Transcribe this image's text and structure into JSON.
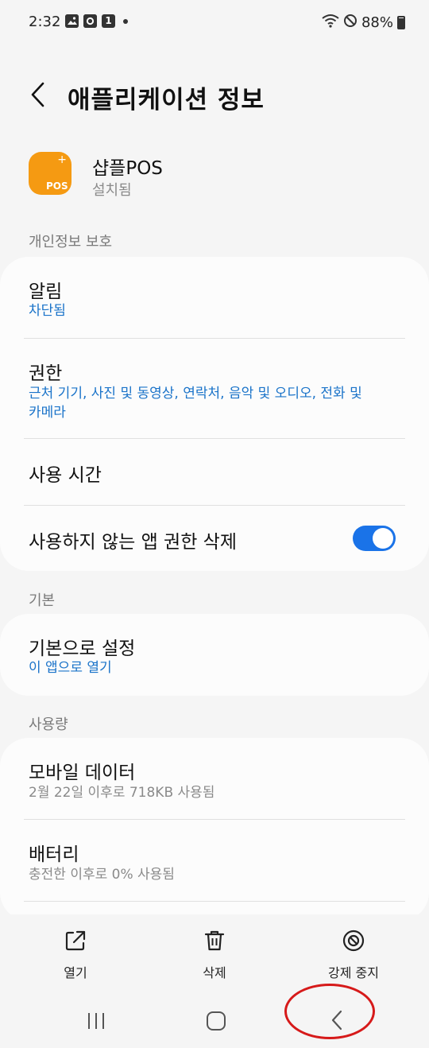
{
  "status_bar": {
    "time": "2:32",
    "left_icons": [
      "gallery-notification-icon",
      "file-notification-icon",
      "one-notification-icon"
    ],
    "one_badge": "1",
    "battery": "88%",
    "right_icons": [
      "wifi-icon",
      "do-not-disturb-icon",
      "battery-icon"
    ]
  },
  "header": {
    "title": "애플리케이션 정보",
    "back_icon": "back-arrow-icon"
  },
  "app": {
    "name": "샵플POS",
    "status": "설치됨",
    "icon_text": "POS",
    "icon_plus": "+",
    "icon_color": "#f59a12"
  },
  "privacy": {
    "section_label": "개인정보 보호",
    "notifications": {
      "title": "알림",
      "value": "차단됨"
    },
    "permissions": {
      "title": "권한",
      "value_line1": "근처 기기, 사진 및 동영상, 연락처, 음악 및 오디오, 전화 및",
      "value_line2": "카메라"
    },
    "screen_time": {
      "title": "사용 시간"
    },
    "remove_permissions": {
      "title": "사용하지 않는 앱 권한 삭제",
      "toggle_on": true
    }
  },
  "defaults": {
    "section_label": "기본",
    "set_default": {
      "title": "기본으로 설정",
      "value": "이 앱으로 열기"
    }
  },
  "usage": {
    "section_label": "사용량",
    "mobile_data": {
      "title": "모바일 데이터",
      "value": "2월 22일 이후로 718KB 사용됨"
    },
    "battery": {
      "title": "배터리",
      "value": "충전한 이후로 0% 사용됨"
    }
  },
  "bottom_actions": [
    {
      "label": "열기",
      "icon": "open-icon"
    },
    {
      "label": "삭제",
      "icon": "trash-icon"
    },
    {
      "label": "강제 중지",
      "icon": "force-stop-icon"
    }
  ],
  "nav_bar": {
    "buttons": [
      "recent-apps-icon",
      "home-icon",
      "back-icon"
    ]
  },
  "colors": {
    "accent": "#1a73e8",
    "link": "#1a73c9",
    "annotation": "#d61a1a"
  }
}
